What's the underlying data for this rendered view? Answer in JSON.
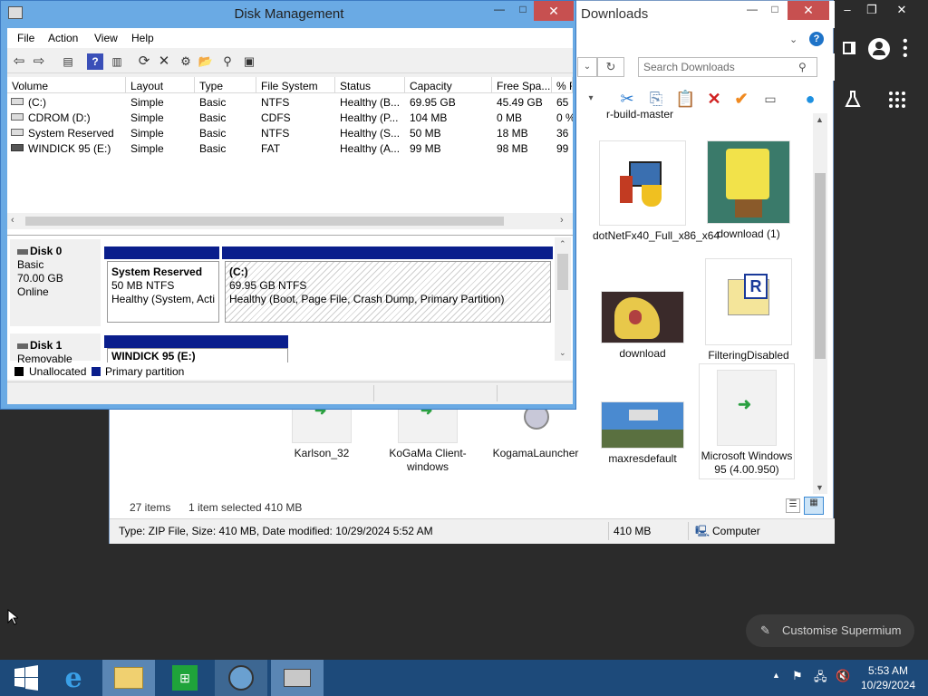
{
  "browser": {
    "window_controls": [
      "–",
      "❐",
      "✕"
    ]
  },
  "explorer": {
    "title": "Downloads",
    "search_placeholder": "Search Downloads",
    "files": [
      {
        "name": "r-build-master"
      },
      {
        "name": "dotNetFx40_Full_x86_x64"
      },
      {
        "name": "download (1)"
      },
      {
        "name": "download"
      },
      {
        "name": "FilteringDisabled"
      },
      {
        "name": "Karlson_32"
      },
      {
        "name": "KoGaMa Client-windows"
      },
      {
        "name": "KogamaLauncher"
      },
      {
        "name": "maxresdefault"
      },
      {
        "name": "Microsoft Windows 95 (4.00.950)"
      }
    ],
    "status": {
      "items": "27 items",
      "selected": "1 item selected  410 MB"
    },
    "statusbar": {
      "info": "Type: ZIP File, Size: 410 MB, Date modified: 10/29/2024 5:52 AM",
      "size": "410 MB",
      "location": "Computer"
    }
  },
  "disk_management": {
    "title": "Disk Management",
    "menu": [
      "File",
      "Action",
      "View",
      "Help"
    ],
    "columns": [
      "Volume",
      "Layout",
      "Type",
      "File System",
      "Status",
      "Capacity",
      "Free Spa...",
      "% F"
    ],
    "volumes": [
      {
        "volume": "(C:)",
        "layout": "Simple",
        "type": "Basic",
        "fs": "NTFS",
        "status": "Healthy (B...",
        "capacity": "69.95 GB",
        "free": "45.49 GB",
        "pct": "65"
      },
      {
        "volume": "CDROM (D:)",
        "layout": "Simple",
        "type": "Basic",
        "fs": "CDFS",
        "status": "Healthy (P...",
        "capacity": "104 MB",
        "free": "0 MB",
        "pct": "0 %"
      },
      {
        "volume": "System Reserved",
        "layout": "Simple",
        "type": "Basic",
        "fs": "NTFS",
        "status": "Healthy (S...",
        "capacity": "50 MB",
        "free": "18 MB",
        "pct": "36"
      },
      {
        "volume": "WINDICK 95 (E:)",
        "layout": "Simple",
        "type": "Basic",
        "fs": "FAT",
        "status": "Healthy (A...",
        "capacity": "99 MB",
        "free": "98 MB",
        "pct": "99"
      }
    ],
    "disks": [
      {
        "name": "Disk 0",
        "kind": "Basic",
        "size": "70.00 GB",
        "state": "Online",
        "partitions": [
          {
            "title": "System Reserved",
            "line1": "50 MB NTFS",
            "line2": "Healthy (System, Acti"
          },
          {
            "title": "(C:)",
            "line1": "69.95 GB NTFS",
            "line2": "Healthy (Boot, Page File, Crash Dump, Primary Partition)"
          }
        ]
      },
      {
        "name": "Disk 1",
        "kind": "Removable",
        "partitions": [
          {
            "title": "WINDICK 95  (E:)"
          }
        ]
      }
    ],
    "legend": {
      "unallocated": "Unallocated",
      "primary": "Primary partition"
    }
  },
  "overlay": {
    "customise": "Customise Supermium"
  },
  "taskbar": {
    "time": "5:53 AM",
    "date": "10/29/2024"
  },
  "colors": {
    "titlebar": "#6aaae4",
    "close": "#c75050",
    "partition": "#0a1e8c",
    "taskbar": "#1d4a7a"
  }
}
